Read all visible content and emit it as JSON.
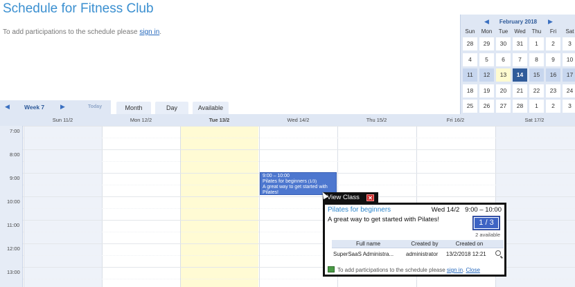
{
  "page": {
    "title": "Schedule for Fitness Club",
    "intro_text": "To add participations to the schedule please",
    "intro_link": "sign in",
    "intro_suffix": "."
  },
  "mini_calendar": {
    "month_title": "February 2018",
    "prev_icon": "triangle-left-icon",
    "next_icon": "triangle-right-icon",
    "weekdays": [
      "Sun",
      "Mon",
      "Tue",
      "Wed",
      "Thu",
      "Fri",
      "Sat"
    ],
    "weeks": [
      [
        "28",
        "29",
        "30",
        "31",
        "1",
        "2",
        "3"
      ],
      [
        "4",
        "5",
        "6",
        "7",
        "8",
        "9",
        "10"
      ],
      [
        "11",
        "12",
        "13",
        "14",
        "15",
        "16",
        "17"
      ],
      [
        "18",
        "19",
        "20",
        "21",
        "22",
        "23",
        "24"
      ],
      [
        "25",
        "26",
        "27",
        "28",
        "1",
        "2",
        "3"
      ]
    ],
    "highlight_week": 2,
    "today": "13",
    "selected": "14"
  },
  "toolbar": {
    "week_label": "Week 7",
    "today_label": "Today",
    "tabs": [
      "Month",
      "Day",
      "Available"
    ]
  },
  "week_view": {
    "day_headers": [
      "Sun 11/2",
      "Mon 12/2",
      "Tue 13/2",
      "Wed 14/2",
      "Thu 15/2",
      "Fri 16/2",
      "Sat 17/2"
    ],
    "times": [
      "7:00",
      "8:00",
      "9:00",
      "10:00",
      "11:00",
      "12:00",
      "13:00"
    ]
  },
  "event": {
    "time": "9:00 – 10:00",
    "title": "Pilates for beginners",
    "count": "(1/3)",
    "description": "A great way to get started with Pilates!"
  },
  "popup": {
    "tab_label": "View Class",
    "close_icon": "close-x-icon",
    "title": "Pilates for beginners",
    "when": "Wed 14/2   9:00 – 10:00",
    "description": "A great way to get started with Pilates!",
    "count": "1 / 3",
    "available": "2 available",
    "columns": [
      "Full name",
      "Created by",
      "Created on"
    ],
    "rows": [
      [
        "SuperSaaS Administra...",
        "administrator",
        "13/2/2018 12:21"
      ]
    ],
    "footer_text": "To add participations to the schedule please",
    "footer_link": "sign in",
    "footer_close": "Close"
  },
  "colors": {
    "accent": "#3a8fd0",
    "event_bg": "#4d77cf",
    "today_bg": "#fffbd4",
    "header_bg": "#dfe7f4"
  }
}
